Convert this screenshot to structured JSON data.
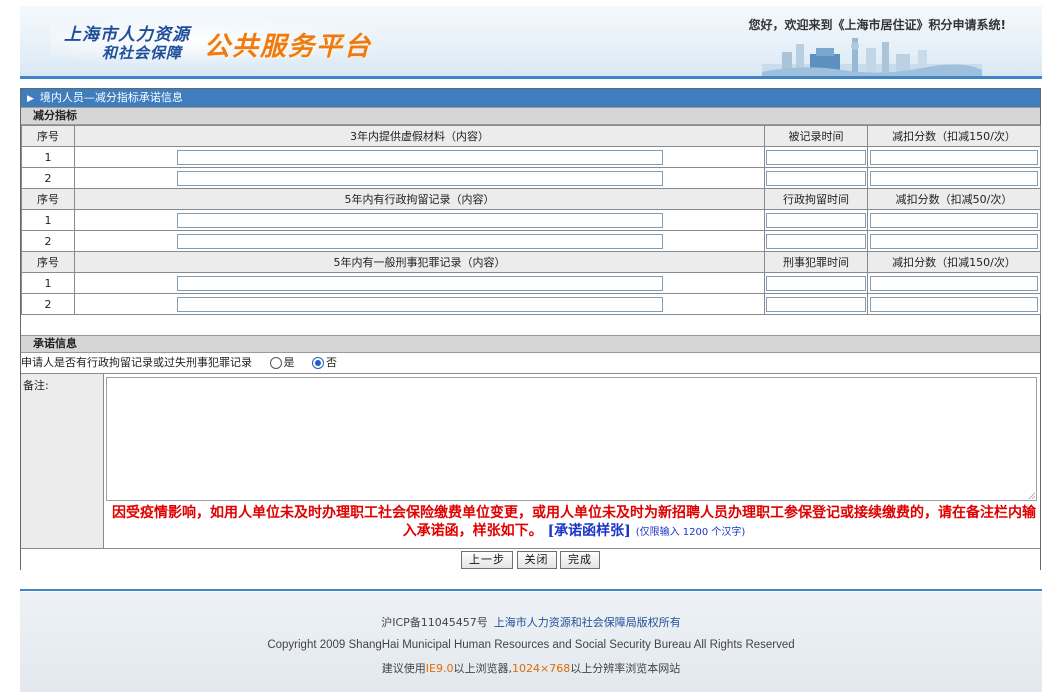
{
  "header": {
    "logo_line1": "上海市人力资源",
    "logo_line2": "和社会保障",
    "platform_title": "公共服务平台",
    "welcome_text": "您好，欢迎来到《上海市居住证》积分申请系统!"
  },
  "form": {
    "title": "境内人员—减分指标承诺信息",
    "section_deduct": "减分指标",
    "groups": [
      {
        "col_seq": "序号",
        "col_content": "3年内提供虚假材料（内容）",
        "col_time": "被记录时间",
        "col_score": "减扣分数（扣减150/次）",
        "rows": [
          "1",
          "2"
        ]
      },
      {
        "col_seq": "序号",
        "col_content": "5年内有行政拘留记录（内容）",
        "col_time": "行政拘留时间",
        "col_score": "减扣分数（扣减50/次）",
        "rows": [
          "1",
          "2"
        ]
      },
      {
        "col_seq": "序号",
        "col_content": "5年内有一般刑事犯罪记录（内容）",
        "col_time": "刑事犯罪时间",
        "col_score": "减扣分数（扣减150/次）",
        "rows": [
          "1",
          "2"
        ]
      }
    ],
    "section_pledge": "承诺信息",
    "pledge_question": "申请人是否有行政拘留记录或过失刑事犯罪记录",
    "option_yes": "是",
    "option_no": "否",
    "selected": "否",
    "remarks_label": "备注:",
    "notice_text": "因受疫情影响，如用人单位未及时办理职工社会保险缴费单位变更，或用人单位未及时为新招聘人员办理职工参保登记或接续缴费的，请在备注栏内输入承诺函，样张如下。",
    "sample_link": "[承诺函样张]",
    "limit_note": "(仅限输入 1200 个汉字)",
    "buttons": {
      "prev": "上一步",
      "close": "关闭",
      "finish": "完成"
    }
  },
  "footer": {
    "icp": "沪ICP备11045457号",
    "copyright_cn": "上海市人力资源和社会保障局版权所有",
    "copyright_en": "Copyright 2009 ShangHai Municipal Human Resources and Social Security Bureau All Rights Reserved",
    "browser_prefix": "建议使用",
    "browser_ie": "IE9.0",
    "browser_mid": "以上浏览器,",
    "browser_res": "1024×768",
    "browser_suffix": "以上分辨率浏览本网站"
  },
  "colors": {
    "title_bar": "#3f7dbd",
    "notice": "#e00000",
    "link": "#1a35c9",
    "platform_title": "#ee7a10"
  }
}
